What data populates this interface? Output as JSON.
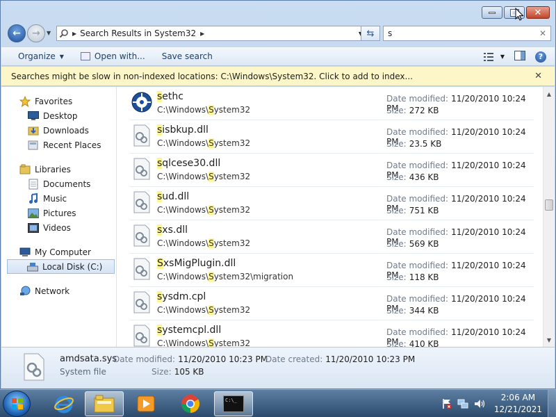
{
  "window": {
    "caption_buttons": [
      "minimize",
      "maximize",
      "close"
    ]
  },
  "address": {
    "crumbs": [
      "Search Results in System32"
    ],
    "search_value": "s",
    "search_clear": "✕"
  },
  "toolbar": {
    "organize": "Organize",
    "open_with": "Open with...",
    "save_search": "Save search"
  },
  "info_bar": {
    "text": "Searches might be slow in non-indexed locations: C:\\Windows\\System32. Click to add to index...",
    "close": "✕"
  },
  "nav_pane": {
    "groups": [
      {
        "header": {
          "label": "Favorites",
          "icon": "star-icon"
        },
        "items": [
          {
            "label": "Desktop",
            "icon": "desktop-icon"
          },
          {
            "label": "Downloads",
            "icon": "downloads-icon"
          },
          {
            "label": "Recent Places",
            "icon": "recent-places-icon"
          }
        ]
      },
      {
        "header": {
          "label": "Libraries",
          "icon": "libraries-icon"
        },
        "items": [
          {
            "label": "Documents",
            "icon": "documents-icon"
          },
          {
            "label": "Music",
            "icon": "music-icon"
          },
          {
            "label": "Pictures",
            "icon": "pictures-icon"
          },
          {
            "label": "Videos",
            "icon": "videos-icon"
          }
        ]
      },
      {
        "header": {
          "label": "My Computer",
          "icon": "computer-icon"
        },
        "items": [
          {
            "label": "Local Disk (C:)",
            "icon": "disk-icon",
            "selected": true
          }
        ]
      },
      {
        "header": {
          "label": "Network",
          "icon": "network-icon"
        },
        "items": []
      }
    ]
  },
  "results": {
    "date_label": "Date modified:",
    "size_label": "Size:",
    "items": [
      {
        "hl": "s",
        "rest": "ethc",
        "path_a": "C:\\Windows\\",
        "path_hl": "S",
        "path_b": "ystem32",
        "date": "11/20/2010 10:24 PM",
        "size": "272 KB",
        "icon": "app-icon"
      },
      {
        "hl": "s",
        "rest": "isbkup.dll",
        "path_a": "C:\\Windows\\",
        "path_hl": "S",
        "path_b": "ystem32",
        "date": "11/20/2010 10:24 PM",
        "size": "23.5 KB",
        "icon": "dll-icon"
      },
      {
        "hl": "s",
        "rest": "qlcese30.dll",
        "path_a": "C:\\Windows\\",
        "path_hl": "S",
        "path_b": "ystem32",
        "date": "11/20/2010 10:24 PM",
        "size": "436 KB",
        "icon": "dll-icon"
      },
      {
        "hl": "s",
        "rest": "ud.dll",
        "path_a": "C:\\Windows\\",
        "path_hl": "S",
        "path_b": "ystem32",
        "date": "11/20/2010 10:24 PM",
        "size": "751 KB",
        "icon": "dll-icon"
      },
      {
        "hl": "s",
        "rest": "xs.dll",
        "path_a": "C:\\Windows\\",
        "path_hl": "S",
        "path_b": "ystem32",
        "date": "11/20/2010 10:24 PM",
        "size": "569 KB",
        "icon": "dll-icon"
      },
      {
        "hl": "S",
        "rest": "xsMigPlugin.dll",
        "path_a": "C:\\Windows\\",
        "path_hl": "S",
        "path_b": "ystem32\\migration",
        "date": "11/20/2010 10:24 PM",
        "size": "118 KB",
        "icon": "dll-icon"
      },
      {
        "hl": "s",
        "rest": "ysdm.cpl",
        "path_a": "C:\\Windows\\",
        "path_hl": "S",
        "path_b": "ystem32",
        "date": "11/20/2010 10:24 PM",
        "size": "344 KB",
        "icon": "dll-icon"
      },
      {
        "hl": "s",
        "rest": "ystemcpl.dll",
        "path_a": "C:\\Windows\\",
        "path_hl": "S",
        "path_b": "ystem32",
        "date": "11/20/2010 10:24 PM",
        "size": "410 KB",
        "icon": "dll-icon"
      }
    ]
  },
  "details": {
    "name": "amdsata.sys",
    "type": "System file",
    "date_modified_label": "Date modified:",
    "date_modified": "11/20/2010 10:23 PM",
    "date_created_label": "Date created:",
    "date_created": "11/20/2010 10:23 PM",
    "size_label": "Size:",
    "size": "105 KB"
  },
  "taskbar": {
    "apps": [
      "internet-explorer-icon",
      "file-explorer-icon",
      "media-player-icon",
      "chrome-icon",
      "command-prompt-icon"
    ],
    "cmd_text": "C:\\_",
    "clock_time": "2:06 AM",
    "clock_date": "12/21/2021"
  }
}
